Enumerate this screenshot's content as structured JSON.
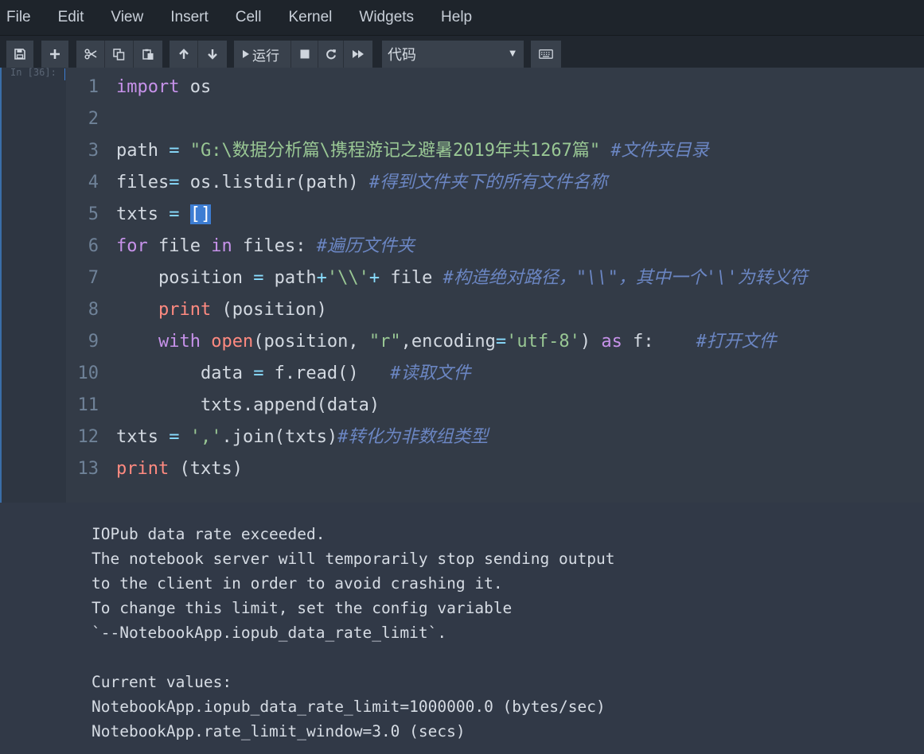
{
  "menubar": {
    "items": [
      {
        "label": "File"
      },
      {
        "label": "Edit"
      },
      {
        "label": "View"
      },
      {
        "label": "Insert"
      },
      {
        "label": "Cell"
      },
      {
        "label": "Kernel"
      },
      {
        "label": "Widgets"
      },
      {
        "label": "Help"
      }
    ]
  },
  "toolbar": {
    "save_icon": "save-icon",
    "add_icon": "plus-icon",
    "cut_icon": "scissors-icon",
    "copy_icon": "copy-icon",
    "paste_icon": "paste-icon",
    "move_up_icon": "arrow-up-icon",
    "move_down_icon": "arrow-down-icon",
    "run_label": "运行",
    "cell_type": "代码",
    "keyboard_icon": "keyboard-icon"
  },
  "cell": {
    "prompt": "In [36]:",
    "lines": [
      {
        "n": "1",
        "tokens": [
          [
            "kw",
            "import"
          ],
          [
            "",
            " os"
          ]
        ]
      },
      {
        "n": "2",
        "tokens": []
      },
      {
        "n": "3",
        "tokens": [
          [
            "",
            "path "
          ],
          [
            "op",
            "="
          ],
          [
            "",
            " "
          ],
          [
            "str",
            "\"G:\\数据分析篇\\携程游记之避暑2019年共1267篇\""
          ],
          [
            "",
            " "
          ],
          [
            "cm",
            "#文件夹目录"
          ]
        ]
      },
      {
        "n": "4",
        "tokens": [
          [
            "",
            "files"
          ],
          [
            "op",
            "="
          ],
          [
            "",
            " os.listdir(path) "
          ],
          [
            "cm",
            "#得到文件夹下的所有文件名称"
          ]
        ]
      },
      {
        "n": "5",
        "tokens": [
          [
            "",
            "txts "
          ],
          [
            "op",
            "="
          ],
          [
            "",
            " "
          ],
          [
            "sel",
            "[]"
          ]
        ]
      },
      {
        "n": "6",
        "tokens": [
          [
            "kw",
            "for"
          ],
          [
            "",
            " file "
          ],
          [
            "kw",
            "in"
          ],
          [
            "",
            " files: "
          ],
          [
            "cm",
            "#遍历文件夹"
          ]
        ]
      },
      {
        "n": "7",
        "tokens": [
          [
            "",
            "    position "
          ],
          [
            "op",
            "="
          ],
          [
            "",
            " path"
          ],
          [
            "op",
            "+"
          ],
          [
            "str",
            "'\\\\'"
          ],
          [
            "op",
            "+"
          ],
          [
            "",
            " file "
          ],
          [
            "cm",
            "#构造绝对路径，\"\\\\\"，其中一个'\\'为转义符"
          ]
        ]
      },
      {
        "n": "8",
        "tokens": [
          [
            "",
            "    "
          ],
          [
            "kw2",
            "print"
          ],
          [
            "",
            " (position)"
          ]
        ]
      },
      {
        "n": "9",
        "tokens": [
          [
            "",
            "    "
          ],
          [
            "kw",
            "with"
          ],
          [
            "",
            " "
          ],
          [
            "kw2",
            "open"
          ],
          [
            "",
            "(position, "
          ],
          [
            "str",
            "\"r\""
          ],
          [
            "",
            ",encoding"
          ],
          [
            "op",
            "="
          ],
          [
            "str",
            "'utf-8'"
          ],
          [
            "",
            ") "
          ],
          [
            "kw",
            "as"
          ],
          [
            "",
            " f:    "
          ],
          [
            "cm",
            "#打开文件"
          ]
        ]
      },
      {
        "n": "10",
        "tokens": [
          [
            "",
            "        data "
          ],
          [
            "op",
            "="
          ],
          [
            "",
            " f.read()   "
          ],
          [
            "cm",
            "#读取文件"
          ]
        ]
      },
      {
        "n": "11",
        "tokens": [
          [
            "",
            "        txts.append(data)"
          ]
        ]
      },
      {
        "n": "12",
        "tokens": [
          [
            "",
            "txts "
          ],
          [
            "op",
            "="
          ],
          [
            "",
            " "
          ],
          [
            "str",
            "','"
          ],
          [
            "",
            ".join(txts)"
          ],
          [
            "cm",
            "#转化为非数组类型"
          ]
        ]
      },
      {
        "n": "13",
        "tokens": [
          [
            "kw2",
            "print"
          ],
          [
            "",
            " (txts)"
          ]
        ]
      }
    ]
  },
  "output": {
    "lines": [
      "IOPub data rate exceeded.",
      "The notebook server will temporarily stop sending output",
      "to the client in order to avoid crashing it.",
      "To change this limit, set the config variable",
      "`--NotebookApp.iopub_data_rate_limit`.",
      "",
      "Current values:",
      "NotebookApp.iopub_data_rate_limit=1000000.0 (bytes/sec)",
      "NotebookApp.rate_limit_window=3.0 (secs)"
    ]
  }
}
